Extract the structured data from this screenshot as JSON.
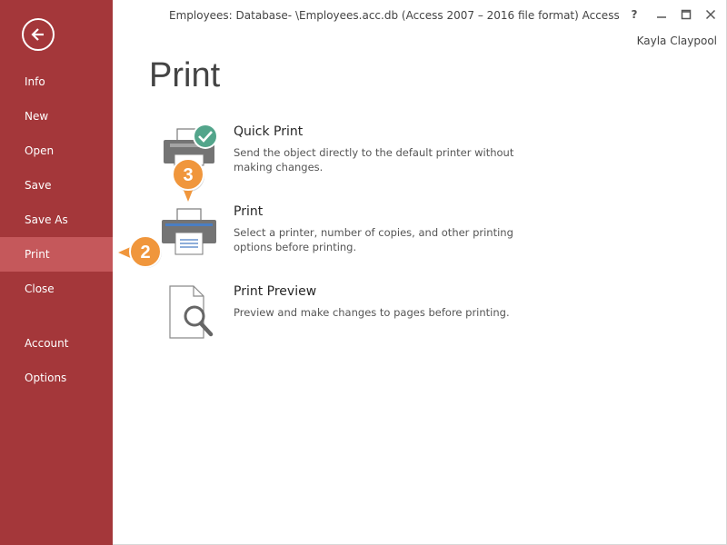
{
  "window": {
    "title": "Employees: Database- \\Employees.acc.db (Access 2007 – 2016 file format) Access",
    "help_label": "?",
    "user_name": "Kayla Claypool"
  },
  "sidebar": {
    "items": [
      {
        "label": "Info"
      },
      {
        "label": "New"
      },
      {
        "label": "Open"
      },
      {
        "label": "Save"
      },
      {
        "label": "Save As"
      },
      {
        "label": "Print"
      },
      {
        "label": "Close"
      },
      {
        "label": "Account"
      },
      {
        "label": "Options"
      }
    ],
    "active": "Print"
  },
  "main": {
    "heading": "Print",
    "options": [
      {
        "title": "Quick Print",
        "description": "Send the object directly to the default printer without making changes."
      },
      {
        "title": "Print",
        "description": "Select a printer, number of copies, and other printing options before printing."
      },
      {
        "title": "Print Preview",
        "description": "Preview and make changes to pages before printing."
      }
    ]
  },
  "callouts": [
    {
      "label": "2"
    },
    {
      "label": "3"
    }
  ],
  "colors": {
    "sidebar_bg": "#a4373a",
    "sidebar_active": "#c5585b",
    "callout": "#f0963c",
    "check": "#53a58b"
  }
}
